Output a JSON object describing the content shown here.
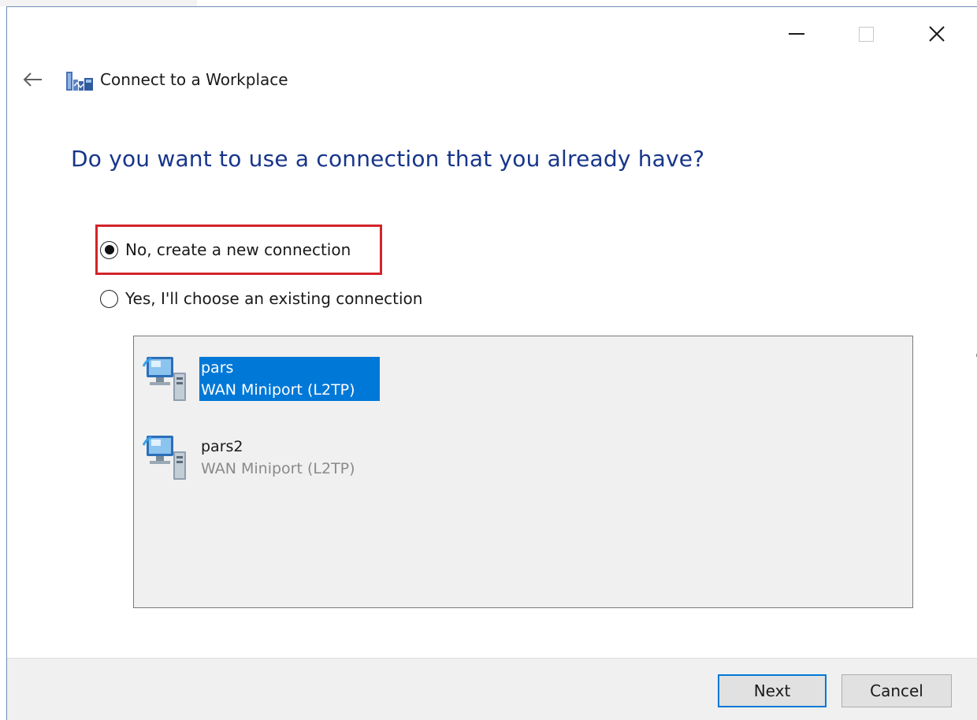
{
  "window": {
    "title": "Connect to a Workplace",
    "controls": {
      "minimize": "minimize",
      "maximize": "maximize",
      "close": "close"
    }
  },
  "page": {
    "question": "Do you want to use a connection that you already have?"
  },
  "options": [
    {
      "label": "No, create a new connection",
      "selected": true
    },
    {
      "label": "Yes, I'll choose an existing connection",
      "selected": false
    }
  ],
  "connections": [
    {
      "name": "pars",
      "device": "WAN Miniport (L2TP)",
      "selected": true
    },
    {
      "name": "pars2",
      "device": "WAN Miniport (L2TP)",
      "selected": false
    }
  ],
  "buttons": {
    "next": "Next",
    "cancel": "Cancel"
  },
  "colors": {
    "heading": "#17358a",
    "selection": "#0078d7",
    "highlight_box": "#d3242b"
  }
}
